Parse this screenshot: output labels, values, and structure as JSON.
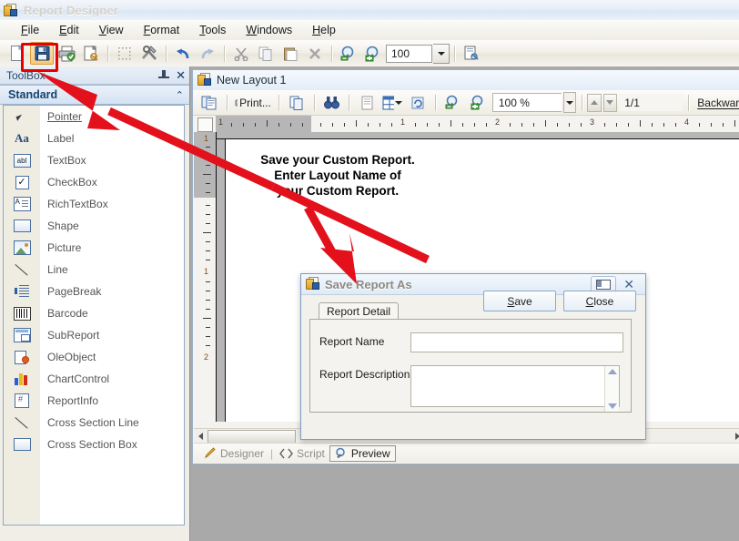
{
  "window": {
    "title": "Report Designer",
    "icon": "report-document-icon"
  },
  "menubar": {
    "items": [
      {
        "label": "File",
        "accel": "F"
      },
      {
        "label": "Edit",
        "accel": "E"
      },
      {
        "label": "View",
        "accel": "V"
      },
      {
        "label": "Format",
        "accel": "F"
      },
      {
        "label": "Tools",
        "accel": "T"
      },
      {
        "label": "Windows",
        "accel": "W"
      },
      {
        "label": "Help",
        "accel": "H"
      }
    ]
  },
  "toolbar": {
    "zoom_value": "100",
    "buttons": [
      {
        "name": "new-document",
        "icon": "new-page-icon"
      },
      {
        "name": "save",
        "icon": "floppy-disk-icon",
        "highlighted": true
      },
      {
        "name": "print",
        "icon": "printer-icon"
      },
      {
        "name": "print-preview",
        "icon": "page-preview-icon"
      },
      {
        "name": "grid",
        "icon": "dotted-grid-icon"
      },
      {
        "name": "tools",
        "icon": "hammer-wrench-icon"
      },
      {
        "name": "undo",
        "icon": "undo-arrow-icon"
      },
      {
        "name": "redo",
        "icon": "redo-arrow-icon"
      },
      {
        "name": "cut",
        "icon": "scissors-icon"
      },
      {
        "name": "copy",
        "icon": "copy-pages-icon"
      },
      {
        "name": "paste",
        "icon": "clipboard-paste-icon"
      },
      {
        "name": "delete",
        "icon": "x-delete-icon"
      },
      {
        "name": "zoom-out",
        "icon": "magnifier-minus-icon"
      },
      {
        "name": "zoom-in",
        "icon": "magnifier-plus-icon"
      },
      {
        "name": "page-setup",
        "icon": "page-settings-icon"
      }
    ]
  },
  "toolbox": {
    "title": "ToolBox",
    "pin_icon": "pushpin-icon",
    "close_icon": "close-icon",
    "section": {
      "label": "Standard",
      "collapse_icon": "chevron-up-icon"
    },
    "items": [
      {
        "label": "Pointer",
        "icon": "cursor-icon",
        "selected": true
      },
      {
        "label": "Label",
        "icon": "label-aa-icon"
      },
      {
        "label": "TextBox",
        "icon": "textbox-abl-icon"
      },
      {
        "label": "CheckBox",
        "icon": "checkbox-icon"
      },
      {
        "label": "RichTextBox",
        "icon": "richtextbox-icon"
      },
      {
        "label": "Shape",
        "icon": "shape-rect-icon"
      },
      {
        "label": "Picture",
        "icon": "picture-icon"
      },
      {
        "label": "Line",
        "icon": "line-icon"
      },
      {
        "label": "PageBreak",
        "icon": "pagebreak-icon"
      },
      {
        "label": "Barcode",
        "icon": "barcode-icon"
      },
      {
        "label": "SubReport",
        "icon": "subreport-icon"
      },
      {
        "label": "OleObject",
        "icon": "oleobject-icon"
      },
      {
        "label": "ChartControl",
        "icon": "chart-bars-icon"
      },
      {
        "label": "ReportInfo",
        "icon": "reportinfo-hash-icon"
      },
      {
        "label": "Cross Section Line",
        "icon": "line-icon"
      },
      {
        "label": "Cross Section Box",
        "icon": "shape-rect-icon"
      }
    ]
  },
  "child_window": {
    "title": "New Layout 1",
    "icon": "report-document-icon",
    "toolbar": {
      "print_label": "Print...",
      "zoom_value": "100 %",
      "page_value": "1/1",
      "backward_label": "Backward",
      "buttons": [
        {
          "name": "copy-report",
          "icon": "copy-report-icon"
        },
        {
          "name": "print",
          "icon": "printer-icon"
        },
        {
          "name": "copy",
          "icon": "copy-icon"
        },
        {
          "name": "find",
          "icon": "binoculars-icon"
        },
        {
          "name": "page-view",
          "icon": "single-page-icon"
        },
        {
          "name": "multi-page-view",
          "icon": "multi-page-grid-icon"
        },
        {
          "name": "refresh",
          "icon": "refresh-icon"
        },
        {
          "name": "zoom-out",
          "icon": "magnifier-minus-icon"
        },
        {
          "name": "zoom-in",
          "icon": "magnifier-plus-icon"
        },
        {
          "name": "prev-page",
          "icon": "up-arrow-icon"
        },
        {
          "name": "next-page",
          "icon": "down-arrow-icon"
        }
      ]
    },
    "rulers": {
      "horizontal_numbers": [
        "1",
        "1",
        "2",
        "3",
        "4"
      ],
      "vertical_numbers": [
        "1",
        "1",
        "2"
      ]
    },
    "view_tabs": [
      {
        "label": "Designer",
        "icon": "pencil-icon",
        "active": false
      },
      {
        "label": "Script",
        "icon": "code-brackets-icon",
        "active": false
      },
      {
        "label": "Preview",
        "icon": "magnifier-icon",
        "active": true
      }
    ]
  },
  "dialog": {
    "title": "Save Report As",
    "icon": "report-document-icon",
    "restore_icon": "restore-window-icon",
    "close_icon": "close-icon",
    "tab": "Report Detail",
    "fields": {
      "report_name": {
        "label": "Report Name",
        "value": "",
        "placeholder": ""
      },
      "report_description": {
        "label": "Report Description",
        "value": "",
        "placeholder": ""
      }
    },
    "buttons": {
      "save": {
        "label": "Save",
        "accel": "S"
      },
      "close": {
        "label": "Close",
        "accel": "C"
      }
    }
  },
  "annotations": {
    "callout_line1": "Save your Custom Report.",
    "callout_line2": "Enter Layout Name of",
    "callout_line3": "your Custom Report.",
    "highlight_color": "#e60000",
    "arrow_color": "#e2111b"
  }
}
